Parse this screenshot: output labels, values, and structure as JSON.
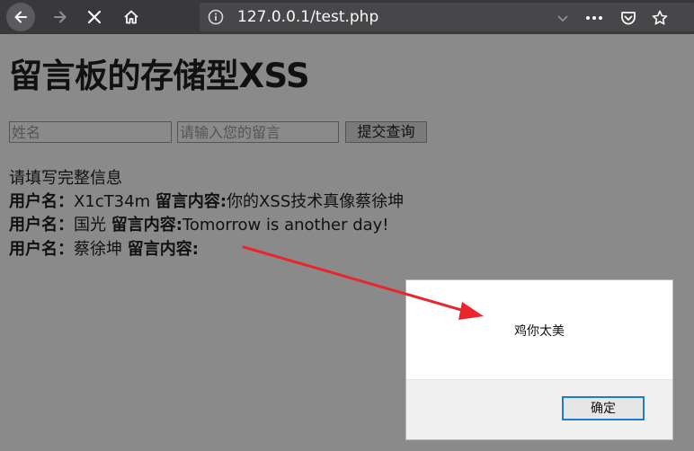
{
  "browser": {
    "url": "127.0.0.1/test.php",
    "icons": [
      "back-icon",
      "forward-icon",
      "stop-icon",
      "home-icon",
      "info-icon",
      "chevron-down-icon",
      "more-icon",
      "pocket-icon",
      "star-icon"
    ]
  },
  "page": {
    "title": "留言板的存储型XSS",
    "form": {
      "name_placeholder": "姓名",
      "message_placeholder": "请输入您的留言",
      "submit_label": "提交查询"
    },
    "notice": "请填写完整信息",
    "user_label": "用户名：",
    "content_label": "留言内容:",
    "entries": [
      {
        "user": "X1cT34m",
        "content": "你的XSS技术真像蔡徐坤"
      },
      {
        "user": "国光",
        "content": "Tomorrow is another day!"
      },
      {
        "user": "蔡徐坤",
        "content": ""
      }
    ]
  },
  "dialog": {
    "message": "鸡你太美",
    "ok_label": "确定"
  },
  "colors": {
    "toolbar": "#38383d",
    "page_bg": "#8a8a8a",
    "arrow": "#e8262b",
    "ok_border": "#1e7bd4"
  }
}
